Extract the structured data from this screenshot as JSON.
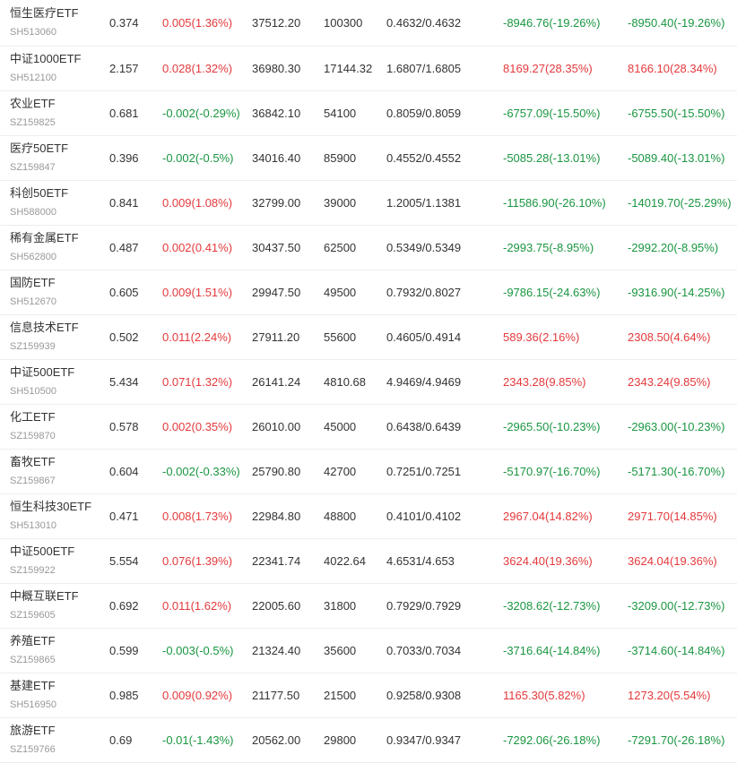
{
  "rows": [
    {
      "name": "恒生医疗ETF",
      "code": "SH513060",
      "price": "0.374",
      "change": "0.005(1.36%)",
      "dir": "up",
      "turnover": "37512.20",
      "volume": "100300",
      "bidask": "0.4632/0.4632",
      "profit1": "-8946.76(-19.26%)",
      "dir1": "down",
      "profit2": "-8950.40(-19.26%)",
      "dir2": "down"
    },
    {
      "name": "中证1000ETF",
      "code": "SH512100",
      "price": "2.157",
      "change": "0.028(1.32%)",
      "dir": "up",
      "turnover": "36980.30",
      "volume": "17144.32",
      "bidask": "1.6807/1.6805",
      "profit1": "8169.27(28.35%)",
      "dir1": "up",
      "profit2": "8166.10(28.34%)",
      "dir2": "up"
    },
    {
      "name": "农业ETF",
      "code": "SZ159825",
      "price": "0.681",
      "change": "-0.002(-0.29%)",
      "dir": "down",
      "turnover": "36842.10",
      "volume": "54100",
      "bidask": "0.8059/0.8059",
      "profit1": "-6757.09(-15.50%)",
      "dir1": "down",
      "profit2": "-6755.50(-15.50%)",
      "dir2": "down"
    },
    {
      "name": "医疗50ETF",
      "code": "SZ159847",
      "price": "0.396",
      "change": "-0.002(-0.5%)",
      "dir": "down",
      "turnover": "34016.40",
      "volume": "85900",
      "bidask": "0.4552/0.4552",
      "profit1": "-5085.28(-13.01%)",
      "dir1": "down",
      "profit2": "-5089.40(-13.01%)",
      "dir2": "down"
    },
    {
      "name": "科创50ETF",
      "code": "SH588000",
      "price": "0.841",
      "change": "0.009(1.08%)",
      "dir": "up",
      "turnover": "32799.00",
      "volume": "39000",
      "bidask": "1.2005/1.1381",
      "profit1": "-11586.90(-26.10%)",
      "dir1": "down",
      "profit2": "-14019.70(-25.29%)",
      "dir2": "down"
    },
    {
      "name": "稀有金属ETF",
      "code": "SH562800",
      "price": "0.487",
      "change": "0.002(0.41%)",
      "dir": "up",
      "turnover": "30437.50",
      "volume": "62500",
      "bidask": "0.5349/0.5349",
      "profit1": "-2993.75(-8.95%)",
      "dir1": "down",
      "profit2": "-2992.20(-8.95%)",
      "dir2": "down"
    },
    {
      "name": "国防ETF",
      "code": "SH512670",
      "price": "0.605",
      "change": "0.009(1.51%)",
      "dir": "up",
      "turnover": "29947.50",
      "volume": "49500",
      "bidask": "0.7932/0.8027",
      "profit1": "-9786.15(-24.63%)",
      "dir1": "down",
      "profit2": "-9316.90(-14.25%)",
      "dir2": "down"
    },
    {
      "name": "信息技术ETF",
      "code": "SZ159939",
      "price": "0.502",
      "change": "0.011(2.24%)",
      "dir": "up",
      "turnover": "27911.20",
      "volume": "55600",
      "bidask": "0.4605/0.4914",
      "profit1": "589.36(2.16%)",
      "dir1": "up",
      "profit2": "2308.50(4.64%)",
      "dir2": "up"
    },
    {
      "name": "中证500ETF",
      "code": "SH510500",
      "price": "5.434",
      "change": "0.071(1.32%)",
      "dir": "up",
      "turnover": "26141.24",
      "volume": "4810.68",
      "bidask": "4.9469/4.9469",
      "profit1": "2343.28(9.85%)",
      "dir1": "up",
      "profit2": "2343.24(9.85%)",
      "dir2": "up"
    },
    {
      "name": "化工ETF",
      "code": "SZ159870",
      "price": "0.578",
      "change": "0.002(0.35%)",
      "dir": "up",
      "turnover": "26010.00",
      "volume": "45000",
      "bidask": "0.6438/0.6439",
      "profit1": "-2965.50(-10.23%)",
      "dir1": "down",
      "profit2": "-2963.00(-10.23%)",
      "dir2": "down"
    },
    {
      "name": "畜牧ETF",
      "code": "SZ159867",
      "price": "0.604",
      "change": "-0.002(-0.33%)",
      "dir": "down",
      "turnover": "25790.80",
      "volume": "42700",
      "bidask": "0.7251/0.7251",
      "profit1": "-5170.97(-16.70%)",
      "dir1": "down",
      "profit2": "-5171.30(-16.70%)",
      "dir2": "down"
    },
    {
      "name": "恒生科技30ETF",
      "code": "SH513010",
      "price": "0.471",
      "change": "0.008(1.73%)",
      "dir": "up",
      "turnover": "22984.80",
      "volume": "48800",
      "bidask": "0.4101/0.4102",
      "profit1": "2967.04(14.82%)",
      "dir1": "up",
      "profit2": "2971.70(14.85%)",
      "dir2": "up"
    },
    {
      "name": "中证500ETF",
      "code": "SZ159922",
      "price": "5.554",
      "change": "0.076(1.39%)",
      "dir": "up",
      "turnover": "22341.74",
      "volume": "4022.64",
      "bidask": "4.6531/4.653",
      "profit1": "3624.40(19.36%)",
      "dir1": "up",
      "profit2": "3624.04(19.36%)",
      "dir2": "up"
    },
    {
      "name": "中概互联ETF",
      "code": "SZ159605",
      "price": "0.692",
      "change": "0.011(1.62%)",
      "dir": "up",
      "turnover": "22005.60",
      "volume": "31800",
      "bidask": "0.7929/0.7929",
      "profit1": "-3208.62(-12.73%)",
      "dir1": "down",
      "profit2": "-3209.00(-12.73%)",
      "dir2": "down"
    },
    {
      "name": "养殖ETF",
      "code": "SZ159865",
      "price": "0.599",
      "change": "-0.003(-0.5%)",
      "dir": "down",
      "turnover": "21324.40",
      "volume": "35600",
      "bidask": "0.7033/0.7034",
      "profit1": "-3716.64(-14.84%)",
      "dir1": "down",
      "profit2": "-3714.60(-14.84%)",
      "dir2": "down"
    },
    {
      "name": "基建ETF",
      "code": "SH516950",
      "price": "0.985",
      "change": "0.009(0.92%)",
      "dir": "up",
      "turnover": "21177.50",
      "volume": "21500",
      "bidask": "0.9258/0.9308",
      "profit1": "1165.30(5.82%)",
      "dir1": "up",
      "profit2": "1273.20(5.54%)",
      "dir2": "up"
    },
    {
      "name": "旅游ETF",
      "code": "SZ159766",
      "price": "0.69",
      "change": "-0.01(-1.43%)",
      "dir": "down",
      "turnover": "20562.00",
      "volume": "29800",
      "bidask": "0.9347/0.9347",
      "profit1": "-7292.06(-26.18%)",
      "dir1": "down",
      "profit2": "-7291.70(-26.18%)",
      "dir2": "down"
    }
  ],
  "colors": {
    "up": "#e4393c",
    "down": "#1a9641",
    "text": "#333333",
    "code": "#999999",
    "divider": "#eeeeee"
  }
}
